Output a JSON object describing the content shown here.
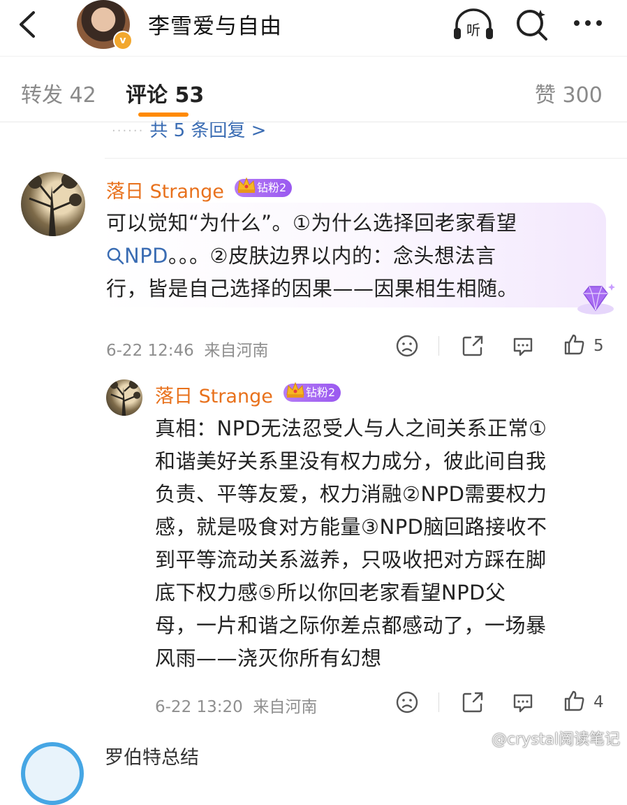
{
  "header": {
    "title": "李雪爱与自由",
    "badge": "v"
  },
  "tabs": {
    "repost": "转发 42",
    "comments": "评论 53",
    "likes": "赞 300"
  },
  "thread": {
    "more_replies": "共 5 条回复 >",
    "comment": {
      "username": "落日 Strange",
      "fan_badge": "钻粉2",
      "text_line1": "可以觉知“为什么”。①为什么选择回老家看望",
      "topic": "NPD",
      "text_line2_rest": "。。。②皮肤边界以内的：念头想法言",
      "text_line3": "行，皆是自己选择的因果——因果相生相随。",
      "timestamp": "6-22 12:46",
      "location": "来自河南",
      "likes": "5"
    },
    "reply": {
      "username": "落日 Strange",
      "fan_badge": "钻粉2",
      "lines": [
        "真相：NPD无法忍受人与人之间关系正常①",
        "和谐美好关系里没有权力成分，彼此间自我",
        "负责、平等友爱，权力消融②NPD需要权力",
        "感，就是吸食对方能量③NPD脑回路接收不",
        "到平等流动关系滋养，只吸收把对方踩在脚",
        "底下权力感⑤所以你回老家看望NPD父",
        "母，一片和谐之际你差点都感动了，一场暴",
        "风雨——浇灭你所有幻想"
      ],
      "timestamp": "6-22 13:20",
      "location": "来自河南",
      "likes": "4"
    },
    "next_comment_user": "罗伯特总结"
  },
  "watermark": "@crystal阅读笔记",
  "icons": [
    "back-arrow-icon",
    "listen-icon",
    "search-icon",
    "more-icon",
    "crown-icon",
    "gem-icon",
    "dislike-icon",
    "share-icon",
    "comment-icon",
    "like-icon"
  ],
  "colors": {
    "accent": "#ff8a00",
    "username": "#e8711c",
    "link": "#3a6cb3",
    "fan_badge": "#9a59f0"
  }
}
